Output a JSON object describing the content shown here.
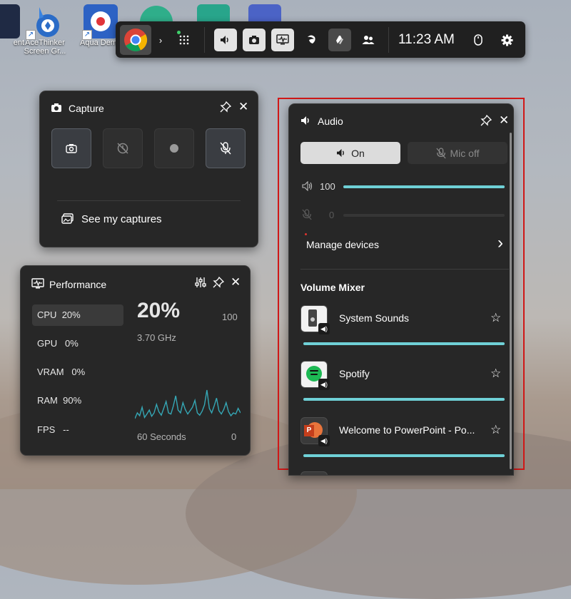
{
  "desktop": {
    "icons": [
      {
        "label": "ent",
        "label2": ""
      },
      {
        "label": "AceThinker",
        "label2": "Screen Gr..."
      },
      {
        "label": "Aqua Dem",
        "label2": ""
      },
      {
        "label": "",
        "label2": ""
      },
      {
        "label": "",
        "label2": ""
      },
      {
        "label": "",
        "label2": ""
      }
    ]
  },
  "gamebar": {
    "clock": "11:23 AM",
    "buttons": [
      "chrome-icon",
      "chevron-right-icon",
      "widget-menu-icon",
      "audio-icon",
      "capture-icon",
      "performance-icon",
      "xbox-social-icon",
      "spotify-widget-icon",
      "people-icon",
      "mouse-icon",
      "settings-icon"
    ]
  },
  "capture": {
    "title": "Capture",
    "see_captures": "See my captures"
  },
  "performance": {
    "title": "Performance",
    "rows": [
      {
        "label": "CPU",
        "value": "20%"
      },
      {
        "label": "GPU",
        "value": "0%"
      },
      {
        "label": "VRAM",
        "value": "0%"
      },
      {
        "label": "RAM",
        "value": "90%"
      },
      {
        "label": "FPS",
        "value": "--"
      }
    ],
    "big_value": "20%",
    "max_value": "100",
    "frequency": "3.70 GHz",
    "graph_label": "60 Seconds",
    "graph_min": "0",
    "graph_series": [
      20,
      30,
      25,
      40,
      22,
      28,
      35,
      24,
      30,
      45,
      32,
      26,
      38,
      50,
      30,
      28,
      42,
      60,
      35,
      30,
      48,
      36,
      28,
      34,
      40,
      52,
      30,
      26,
      33,
      44,
      70,
      38,
      30,
      42,
      56,
      34,
      28,
      36,
      48,
      32,
      25,
      30,
      28,
      38,
      30
    ]
  },
  "audio": {
    "title": "Audio",
    "on_label": "On",
    "mic_off_label": "Mic off",
    "speaker_volume": "100",
    "speaker_level": 1.0,
    "mic_volume": "0",
    "mic_level": 0.0,
    "manage_devices": "Manage devices",
    "mixer_title": "Volume Mixer",
    "mixer": [
      {
        "name": "System Sounds",
        "icon": "system-sounds-icon",
        "level": 1.0
      },
      {
        "name": "Spotify",
        "icon": "spotify-icon",
        "level": 1.0
      },
      {
        "name": "Welcome to PowerPoint - Po...",
        "icon": "powerpoint-icon",
        "level": 1.0
      }
    ],
    "accent": "#6fd0d6",
    "highlight_border": "#d11818"
  }
}
